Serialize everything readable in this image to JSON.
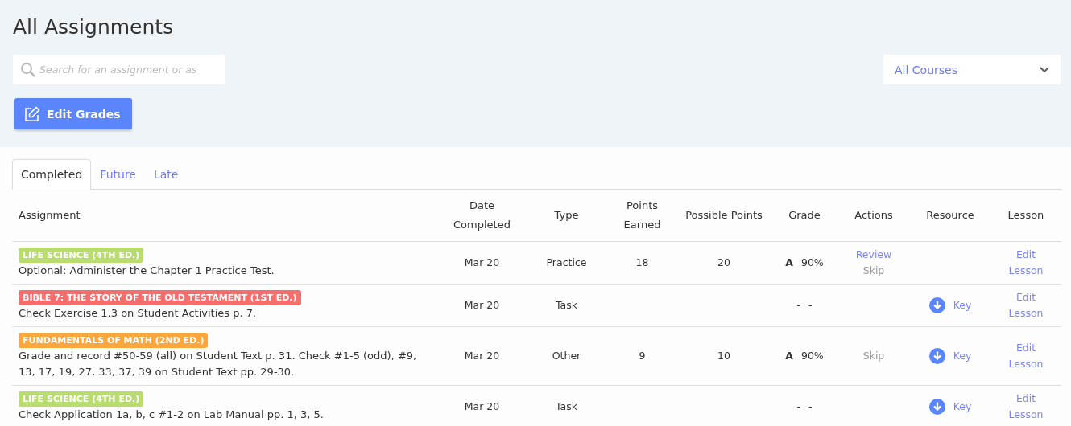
{
  "title": "All Assignments",
  "search": {
    "placeholder": "Search for an assignment or as"
  },
  "course_filter": {
    "value": "All Courses"
  },
  "edit_button": {
    "label": "Edit Grades"
  },
  "tabs": [
    {
      "label": "Completed",
      "selected": true
    },
    {
      "label": "Future",
      "selected": false
    },
    {
      "label": "Late",
      "selected": false
    }
  ],
  "table": {
    "columns": [
      "Assignment",
      "Date Completed",
      "Type",
      "Points Earned",
      "Possible Points",
      "Grade",
      "Actions",
      "Resource",
      "Lesson"
    ],
    "rows": [
      {
        "course": "LIFE SCIENCE (4TH ED.)",
        "color": "#b9dc6f",
        "description": "Optional: Administer the Chapter 1 Practice Test.",
        "date": "Mar 20",
        "type": "Practice",
        "earned": "18",
        "possible": "20",
        "grade": {
          "letter": "A",
          "percent": "90%"
        },
        "actions": [
          {
            "label": "Review",
            "kind": "link"
          },
          {
            "label": "Skip",
            "kind": "muted"
          }
        ],
        "lesson": "Edit Lesson"
      },
      {
        "course": "BIBLE 7: THE STORY OF THE OLD TESTAMENT (1ST ED.)",
        "color": "#f76d6b",
        "description": "Check Exercise 1.3 on Student Activities p. 7.",
        "date": "Mar 20",
        "type": "Task",
        "grade": {
          "letter": "-",
          "percent": "-"
        },
        "resource": "Key",
        "lesson": "Edit Lesson"
      },
      {
        "course": "FUNDAMENTALS OF MATH (2ND ED.)",
        "color": "#fba73e",
        "description": "Grade and record #50-59 (all) on Student Text p. 31. Check #1-5 (odd), #9, 13, 17, 19, 27, 33, 37, 39 on Student Text pp. 29-30.",
        "date": "Mar 20",
        "type": "Other",
        "earned": "9",
        "possible": "10",
        "grade": {
          "letter": "A",
          "percent": "90%"
        },
        "actions": [
          {
            "label": "Skip",
            "kind": "muted"
          }
        ],
        "resource": "Key",
        "lesson": "Edit Lesson"
      },
      {
        "course": "LIFE SCIENCE (4TH ED.)",
        "color": "#b9dc6f",
        "description": "Check Application 1a, b, c #1-2 on Lab Manual pp. 1, 3, 5.",
        "date": "Mar 20",
        "type": "Task",
        "grade": {
          "letter": "-",
          "percent": "-"
        },
        "resource": "Key",
        "lesson": "Edit Lesson"
      }
    ]
  }
}
